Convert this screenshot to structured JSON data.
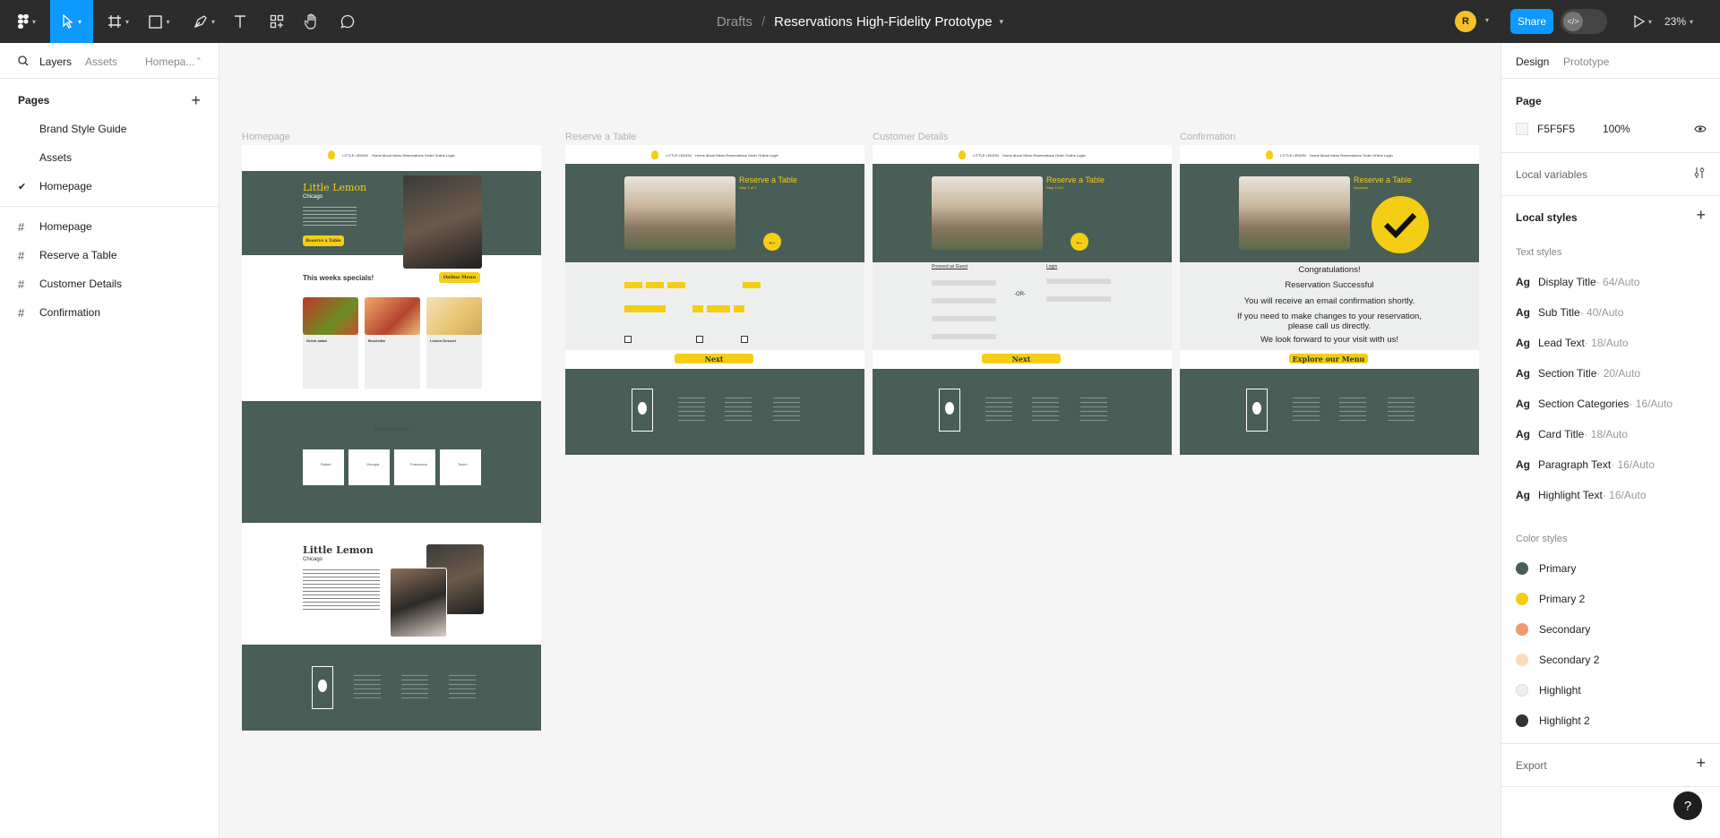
{
  "toolbar": {
    "breadcrumb_parent": "Drafts",
    "breadcrumb_separator": "/",
    "file_name": "Reservations High-Fidelity Prototype",
    "avatar_initial": "R",
    "share_label": "Share",
    "zoom_level": "23%"
  },
  "left_panel": {
    "tabs": [
      "Layers",
      "Assets",
      "Homepa..."
    ],
    "pages_title": "Pages",
    "pages": [
      "Brand Style Guide",
      "Assets",
      "Homepage"
    ],
    "current_page": "Homepage",
    "layers": [
      "Homepage",
      "Reserve a Table",
      "Customer Details",
      "Confirmation"
    ]
  },
  "right_panel": {
    "tabs": [
      "Design",
      "Prototype"
    ],
    "page_title": "Page",
    "page_color": "F5F5F5",
    "page_opacity": "100%",
    "local_variables": "Local variables",
    "local_styles": "Local styles",
    "text_styles_title": "Text styles",
    "text_styles": [
      {
        "name": "Display Title",
        "meta": " · 64/Auto"
      },
      {
        "name": "Sub Title",
        "meta": " · 40/Auto"
      },
      {
        "name": "Lead Text",
        "meta": " · 18/Auto"
      },
      {
        "name": "Section Title",
        "meta": " · 20/Auto"
      },
      {
        "name": "Section Categories",
        "meta": " · 16/Auto"
      },
      {
        "name": "Card Title",
        "meta": " · 18/Auto"
      },
      {
        "name": "Paragraph Text",
        "meta": " · 16/Auto"
      },
      {
        "name": "Highlight Text",
        "meta": " · 16/Auto"
      }
    ],
    "color_styles_title": "Color styles",
    "color_styles": [
      {
        "name": "Primary",
        "color": "#495E57"
      },
      {
        "name": "Primary 2",
        "color": "#F4CE14"
      },
      {
        "name": "Secondary",
        "color": "#EE9972"
      },
      {
        "name": "Secondary 2",
        "color": "#FBDABB"
      },
      {
        "name": "Highlight",
        "color": "#EDEFEE"
      },
      {
        "name": "Highlight 2",
        "color": "#333333"
      }
    ],
    "export": "Export",
    "help": "?"
  },
  "canvas": {
    "frames": [
      {
        "label": "Homepage"
      },
      {
        "label": "Reserve a Table"
      },
      {
        "label": "Customer Details"
      },
      {
        "label": "Confirmation"
      }
    ],
    "home": {
      "hero_title": "Little Lemon",
      "hero_sub": "Chicago",
      "hero_button": "Reserve a Table",
      "specials": "This weeks specials!",
      "online_menu": "Online Menu",
      "card_titles": [
        "Greek salad",
        "Bruchetta",
        "Lemon Dessert"
      ],
      "testimonials_title": "Testimonials",
      "testimonial_names": [
        "Rafael",
        "Georgia",
        "Francesca",
        "Tosch"
      ],
      "about_title": "Little Lemon",
      "about_sub": "Chicago"
    },
    "reserve": {
      "title": "Reserve a Table",
      "step": "Step 1 of 2",
      "next": "Next"
    },
    "details": {
      "title": "Reserve a Table",
      "step": "Step 2 of 2",
      "guest": "Proceed as Guest",
      "login": "Login",
      "or": "-OR-",
      "next": "Next"
    },
    "confirm": {
      "title": "Reserve a Table",
      "step": "Success!",
      "line1": "Congratulations!",
      "line2": "Reservation Successful",
      "line3": "You will receive an email confirmation shortly.",
      "line4": "If you need to make changes to your reservation, please call us directly.",
      "line5": "We look forward to your visit with us!",
      "button": "Explore our Menu"
    }
  }
}
